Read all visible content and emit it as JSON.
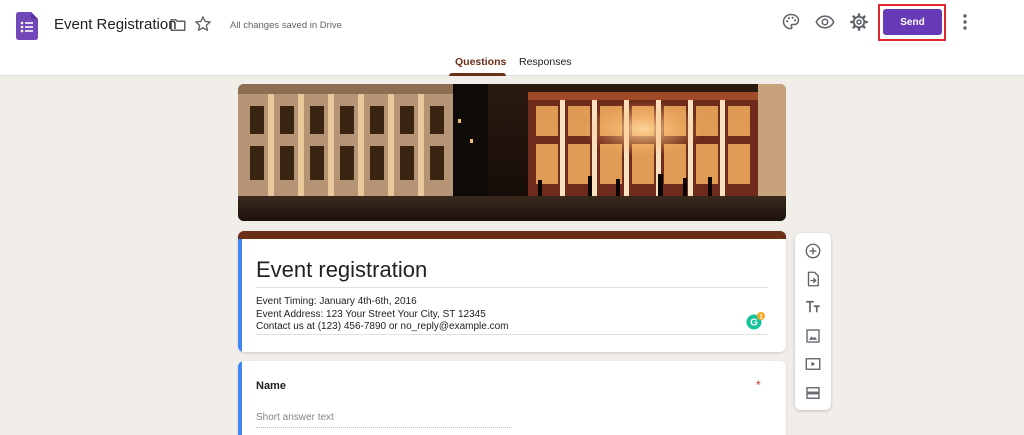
{
  "header": {
    "doc_title": "Event Registration",
    "save_status": "All changes saved in Drive",
    "send_label": "Send",
    "icons": [
      "forms-logo",
      "folder-icon",
      "star-icon",
      "palette-icon",
      "preview-icon",
      "settings-icon",
      "more-vert-icon"
    ]
  },
  "tabs": [
    {
      "label": "Questions",
      "active": true
    },
    {
      "label": "Responses",
      "active": false
    }
  ],
  "form": {
    "title": "Event registration",
    "description": [
      "Event Timing: January 4th-6th, 2016",
      "Event Address: 123 Your Street Your City, ST 12345",
      "Contact us at (123) 456-7890 or no_reply@example.com"
    ],
    "questions": [
      {
        "title": "Name",
        "required_mark": "*",
        "placeholder": "Short answer text"
      }
    ]
  },
  "grammarly_badge": "1",
  "toolbar": {
    "icons": [
      "add-question-icon",
      "import-questions-icon",
      "add-title-icon",
      "add-image-icon",
      "add-video-icon",
      "add-section-icon"
    ]
  },
  "colors": {
    "accent": "#673ab7",
    "theme": "#6b2f17",
    "focus_bar": "#4285f4",
    "background": "#f1ede9",
    "highlight": "#e0272d"
  }
}
